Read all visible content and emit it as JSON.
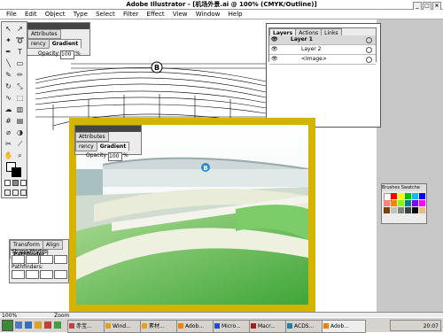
{
  "title": "Adobe Illustrator - [机场外景.ai @ 100% (CMYK/Outline)]",
  "menu": [
    "File",
    "Edit",
    "Object",
    "Type",
    "Select",
    "Filter",
    "Effect",
    "View",
    "Window",
    "Help"
  ],
  "top_palette": {
    "tab_attributes": "Attributes",
    "tab_transparency": "rency",
    "tab_gradient": "Gradient",
    "opacity_label": "Opacity",
    "opacity_value": "100",
    "opacity_unit": "%"
  },
  "layers": {
    "tabs": [
      "Layers",
      "Actions",
      "Links"
    ],
    "rows": [
      "Layer 1",
      "Layer 2",
      "<Image>"
    ]
  },
  "float_palette": {
    "tab_attributes": "Attributes",
    "tab_transparency": "rency",
    "tab_gradient": "Gradient",
    "opacity_label": "Opacity",
    "opacity_value": "100",
    "opacity_unit": "%"
  },
  "callout": "B",
  "render_callout": "B",
  "swatches_tab": "Brushes Swatche",
  "pathfinder": {
    "tabs": [
      "Transform",
      "Align",
      "Pathfinder"
    ],
    "shape_modes": "Shape Modes:",
    "pathfinders": "Pathfinders:",
    "expand": "Expand"
  },
  "status": {
    "zoom": "100%",
    "zoom_label": "Zoom"
  },
  "taskbar": {
    "items": [
      "赤宝...",
      "Wind...",
      "素材...",
      "Adob...",
      "Micro...",
      "Macr...",
      "ACDS...",
      "Adob..."
    ],
    "clock": "20:07"
  }
}
